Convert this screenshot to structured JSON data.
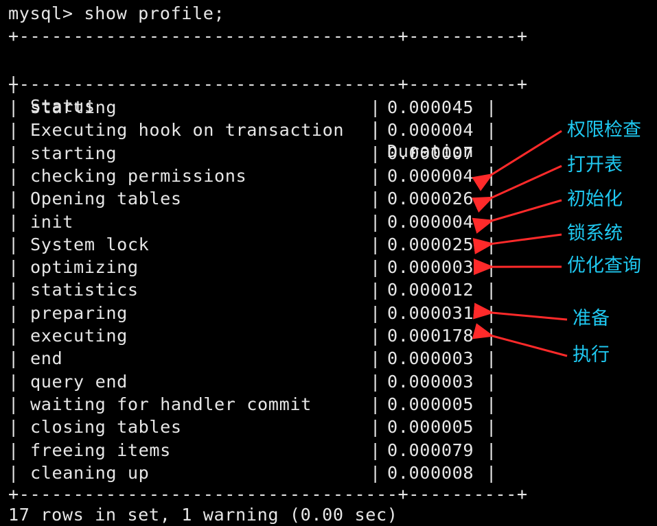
{
  "terminal": {
    "prompt": "mysql> show profile;",
    "border": "+-----------------------------------+----------+",
    "pipe": "|",
    "columns": [
      "Status",
      "Duration"
    ],
    "rows": [
      {
        "status": "starting",
        "duration": "0.000045"
      },
      {
        "status": "Executing hook on transaction",
        "duration": "0.000004"
      },
      {
        "status": "starting",
        "duration": "0.000007"
      },
      {
        "status": "checking permissions",
        "duration": "0.000004"
      },
      {
        "status": "Opening tables",
        "duration": "0.000026"
      },
      {
        "status": "init",
        "duration": "0.000004"
      },
      {
        "status": "System lock",
        "duration": "0.000025"
      },
      {
        "status": "optimizing",
        "duration": "0.000003"
      },
      {
        "status": "statistics",
        "duration": "0.000012"
      },
      {
        "status": "preparing",
        "duration": "0.000031"
      },
      {
        "status": "executing",
        "duration": "0.000178"
      },
      {
        "status": "end",
        "duration": "0.000003"
      },
      {
        "status": "query end",
        "duration": "0.000003"
      },
      {
        "status": "waiting for handler commit",
        "duration": "0.000005"
      },
      {
        "status": "closing tables",
        "duration": "0.000005"
      },
      {
        "status": "freeing items",
        "duration": "0.000079"
      },
      {
        "status": "cleaning up",
        "duration": "0.000008"
      }
    ],
    "footer": "17 rows in set, 1 warning (0.00 sec)"
  },
  "annotations": [
    {
      "label": "权限检查",
      "target_row": 3
    },
    {
      "label": "打开表",
      "target_row": 4
    },
    {
      "label": "初始化",
      "target_row": 5
    },
    {
      "label": "锁系统",
      "target_row": 6
    },
    {
      "label": "优化查询",
      "target_row": 7
    },
    {
      "label": "准备",
      "target_row": 9
    },
    {
      "label": "执行",
      "target_row": 10
    }
  ],
  "colors": {
    "background": "#000000",
    "text": "#e6e6e6",
    "annotation_text": "#1fc8f0",
    "arrow": "#ff2a2a"
  }
}
